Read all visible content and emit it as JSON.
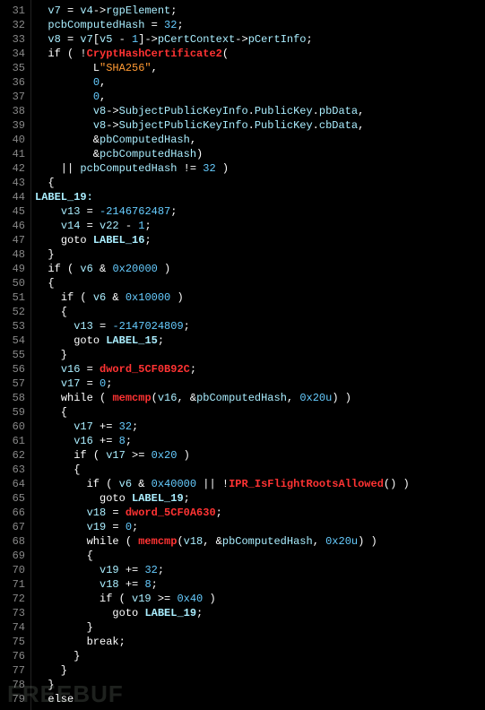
{
  "watermark": "FREEBUF",
  "first_line_no": 31,
  "code_lines": [
    [
      [
        "  ",
        "c"
      ],
      [
        "v7",
        "var"
      ],
      [
        " = ",
        "c"
      ],
      [
        "v4",
        "var"
      ],
      [
        "->",
        "c"
      ],
      [
        "rgpElement",
        "var"
      ],
      [
        ";",
        "c"
      ]
    ],
    [
      [
        "  ",
        "c"
      ],
      [
        "pcbComputedHash",
        "var"
      ],
      [
        " = ",
        "c"
      ],
      [
        "32",
        "num"
      ],
      [
        ";",
        "c"
      ]
    ],
    [
      [
        "  ",
        "c"
      ],
      [
        "v8",
        "var"
      ],
      [
        " = ",
        "c"
      ],
      [
        "v7",
        "var"
      ],
      [
        "[",
        "c"
      ],
      [
        "v5",
        "var"
      ],
      [
        " - ",
        "c"
      ],
      [
        "1",
        "num"
      ],
      [
        "]->",
        "c"
      ],
      [
        "pCertContext",
        "var"
      ],
      [
        "->",
        "c"
      ],
      [
        "pCertInfo",
        "var"
      ],
      [
        ";",
        "c"
      ]
    ],
    [
      [
        "  ",
        "c"
      ],
      [
        "if",
        "kw"
      ],
      [
        " ( !",
        "c"
      ],
      [
        "CryptHashCertificate2",
        "func"
      ],
      [
        "(",
        "c"
      ]
    ],
    [
      [
        "         ",
        "c"
      ],
      [
        "L",
        "kw"
      ],
      [
        "\"SHA256\"",
        "str"
      ],
      [
        ",",
        "c"
      ]
    ],
    [
      [
        "         ",
        "c"
      ],
      [
        "0",
        "num"
      ],
      [
        ",",
        "c"
      ]
    ],
    [
      [
        "         ",
        "c"
      ],
      [
        "0",
        "num"
      ],
      [
        ",",
        "c"
      ]
    ],
    [
      [
        "         ",
        "c"
      ],
      [
        "v8",
        "var"
      ],
      [
        "->",
        "c"
      ],
      [
        "SubjectPublicKeyInfo",
        "var"
      ],
      [
        ".",
        "c"
      ],
      [
        "PublicKey",
        "var"
      ],
      [
        ".",
        "c"
      ],
      [
        "pbData",
        "var"
      ],
      [
        ",",
        "c"
      ]
    ],
    [
      [
        "         ",
        "c"
      ],
      [
        "v8",
        "var"
      ],
      [
        "->",
        "c"
      ],
      [
        "SubjectPublicKeyInfo",
        "var"
      ],
      [
        ".",
        "c"
      ],
      [
        "PublicKey",
        "var"
      ],
      [
        ".",
        "c"
      ],
      [
        "cbData",
        "var"
      ],
      [
        ",",
        "c"
      ]
    ],
    [
      [
        "         &",
        "c"
      ],
      [
        "pbComputedHash",
        "var"
      ],
      [
        ",",
        "c"
      ]
    ],
    [
      [
        "         &",
        "c"
      ],
      [
        "pcbComputedHash",
        "var"
      ],
      [
        ")",
        "c"
      ]
    ],
    [
      [
        "    || ",
        "c"
      ],
      [
        "pcbComputedHash",
        "var"
      ],
      [
        " != ",
        "c"
      ],
      [
        "32",
        "num"
      ],
      [
        " )",
        "c"
      ]
    ],
    [
      [
        "  {",
        "c"
      ]
    ],
    [
      [
        "LABEL_19:",
        "lbl"
      ]
    ],
    [
      [
        "    ",
        "c"
      ],
      [
        "v13",
        "var"
      ],
      [
        " = ",
        "c"
      ],
      [
        "-2146762487",
        "num"
      ],
      [
        ";",
        "c"
      ]
    ],
    [
      [
        "    ",
        "c"
      ],
      [
        "v14",
        "var"
      ],
      [
        " = ",
        "c"
      ],
      [
        "v22",
        "var"
      ],
      [
        " - ",
        "c"
      ],
      [
        "1",
        "num"
      ],
      [
        ";",
        "c"
      ]
    ],
    [
      [
        "    ",
        "c"
      ],
      [
        "goto",
        "kw"
      ],
      [
        " ",
        "c"
      ],
      [
        "LABEL_16",
        "lbl"
      ],
      [
        ";",
        "c"
      ]
    ],
    [
      [
        "  }",
        "c"
      ]
    ],
    [
      [
        "  ",
        "c"
      ],
      [
        "if",
        "kw"
      ],
      [
        " ( ",
        "c"
      ],
      [
        "v6",
        "var"
      ],
      [
        " & ",
        "c"
      ],
      [
        "0x20000",
        "num"
      ],
      [
        " )",
        "c"
      ]
    ],
    [
      [
        "  {",
        "c"
      ]
    ],
    [
      [
        "    ",
        "c"
      ],
      [
        "if",
        "kw"
      ],
      [
        " ( ",
        "c"
      ],
      [
        "v6",
        "var"
      ],
      [
        " & ",
        "c"
      ],
      [
        "0x10000",
        "num"
      ],
      [
        " )",
        "c"
      ]
    ],
    [
      [
        "    {",
        "c"
      ]
    ],
    [
      [
        "      ",
        "c"
      ],
      [
        "v13",
        "var"
      ],
      [
        " = ",
        "c"
      ],
      [
        "-2147024809",
        "num"
      ],
      [
        ";",
        "c"
      ]
    ],
    [
      [
        "      ",
        "c"
      ],
      [
        "goto",
        "kw"
      ],
      [
        " ",
        "c"
      ],
      [
        "LABEL_15",
        "lbl"
      ],
      [
        ";",
        "c"
      ]
    ],
    [
      [
        "    }",
        "c"
      ]
    ],
    [
      [
        "    ",
        "c"
      ],
      [
        "v16",
        "var"
      ],
      [
        " = ",
        "c"
      ],
      [
        "dword_5CF0B92C",
        "func"
      ],
      [
        ";",
        "c"
      ]
    ],
    [
      [
        "    ",
        "c"
      ],
      [
        "v17",
        "var"
      ],
      [
        " = ",
        "c"
      ],
      [
        "0",
        "num"
      ],
      [
        ";",
        "c"
      ]
    ],
    [
      [
        "    ",
        "c"
      ],
      [
        "while",
        "kw"
      ],
      [
        " ( ",
        "c"
      ],
      [
        "memcmp",
        "func"
      ],
      [
        "(",
        "c"
      ],
      [
        "v16",
        "var"
      ],
      [
        ", &",
        "c"
      ],
      [
        "pbComputedHash",
        "var"
      ],
      [
        ", ",
        "c"
      ],
      [
        "0x20u",
        "num"
      ],
      [
        ") )",
        "c"
      ]
    ],
    [
      [
        "    {",
        "c"
      ]
    ],
    [
      [
        "      ",
        "c"
      ],
      [
        "v17",
        "var"
      ],
      [
        " += ",
        "c"
      ],
      [
        "32",
        "num"
      ],
      [
        ";",
        "c"
      ]
    ],
    [
      [
        "      ",
        "c"
      ],
      [
        "v16",
        "var"
      ],
      [
        " += ",
        "c"
      ],
      [
        "8",
        "num"
      ],
      [
        ";",
        "c"
      ]
    ],
    [
      [
        "      ",
        "c"
      ],
      [
        "if",
        "kw"
      ],
      [
        " ( ",
        "c"
      ],
      [
        "v17",
        "var"
      ],
      [
        " >= ",
        "c"
      ],
      [
        "0x20",
        "num"
      ],
      [
        " )",
        "c"
      ]
    ],
    [
      [
        "      {",
        "c"
      ]
    ],
    [
      [
        "        ",
        "c"
      ],
      [
        "if",
        "kw"
      ],
      [
        " ( ",
        "c"
      ],
      [
        "v6",
        "var"
      ],
      [
        " & ",
        "c"
      ],
      [
        "0x40000",
        "num"
      ],
      [
        " || !",
        "c"
      ],
      [
        "IPR_IsFlightRootsAllowed",
        "func"
      ],
      [
        "() )",
        "c"
      ]
    ],
    [
      [
        "          ",
        "c"
      ],
      [
        "goto",
        "kw"
      ],
      [
        " ",
        "c"
      ],
      [
        "LABEL_19",
        "lbl"
      ],
      [
        ";",
        "c"
      ]
    ],
    [
      [
        "        ",
        "c"
      ],
      [
        "v18",
        "var"
      ],
      [
        " = ",
        "c"
      ],
      [
        "dword_5CF0A630",
        "func"
      ],
      [
        ";",
        "c"
      ]
    ],
    [
      [
        "        ",
        "c"
      ],
      [
        "v19",
        "var"
      ],
      [
        " = ",
        "c"
      ],
      [
        "0",
        "num"
      ],
      [
        ";",
        "c"
      ]
    ],
    [
      [
        "        ",
        "c"
      ],
      [
        "while",
        "kw"
      ],
      [
        " ( ",
        "c"
      ],
      [
        "memcmp",
        "func"
      ],
      [
        "(",
        "c"
      ],
      [
        "v18",
        "var"
      ],
      [
        ", &",
        "c"
      ],
      [
        "pbComputedHash",
        "var"
      ],
      [
        ", ",
        "c"
      ],
      [
        "0x20u",
        "num"
      ],
      [
        ") )",
        "c"
      ]
    ],
    [
      [
        "        {",
        "c"
      ]
    ],
    [
      [
        "          ",
        "c"
      ],
      [
        "v19",
        "var"
      ],
      [
        " += ",
        "c"
      ],
      [
        "32",
        "num"
      ],
      [
        ";",
        "c"
      ]
    ],
    [
      [
        "          ",
        "c"
      ],
      [
        "v18",
        "var"
      ],
      [
        " += ",
        "c"
      ],
      [
        "8",
        "num"
      ],
      [
        ";",
        "c"
      ]
    ],
    [
      [
        "          ",
        "c"
      ],
      [
        "if",
        "kw"
      ],
      [
        " ( ",
        "c"
      ],
      [
        "v19",
        "var"
      ],
      [
        " >= ",
        "c"
      ],
      [
        "0x40",
        "num"
      ],
      [
        " )",
        "c"
      ]
    ],
    [
      [
        "            ",
        "c"
      ],
      [
        "goto",
        "kw"
      ],
      [
        " ",
        "c"
      ],
      [
        "LABEL_19",
        "lbl"
      ],
      [
        ";",
        "c"
      ]
    ],
    [
      [
        "        }",
        "c"
      ]
    ],
    [
      [
        "        ",
        "c"
      ],
      [
        "break",
        "kw"
      ],
      [
        ";",
        "c"
      ]
    ],
    [
      [
        "      }",
        "c"
      ]
    ],
    [
      [
        "    }",
        "c"
      ]
    ],
    [
      [
        "  }",
        "c"
      ]
    ],
    [
      [
        "  ",
        "c"
      ],
      [
        "else",
        "kw"
      ]
    ]
  ]
}
